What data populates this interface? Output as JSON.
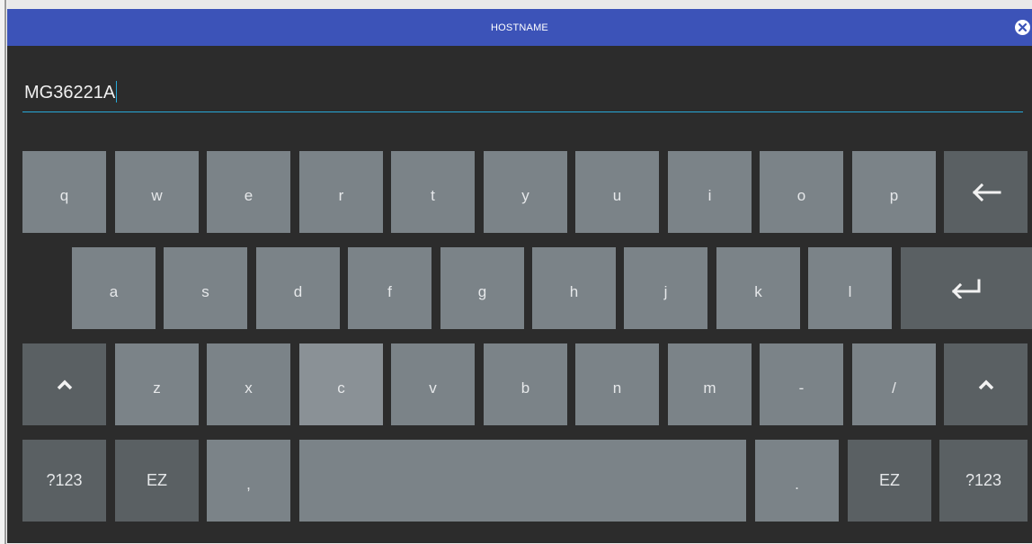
{
  "dialog": {
    "title": "HOSTNAME",
    "close_icon": "close-icon"
  },
  "input": {
    "value": "MG36221A"
  },
  "keyboard": {
    "row1": [
      "q",
      "w",
      "e",
      "r",
      "t",
      "y",
      "u",
      "i",
      "o",
      "p"
    ],
    "row2": [
      "a",
      "s",
      "d",
      "f",
      "g",
      "h",
      "j",
      "k",
      "l"
    ],
    "row3": [
      "z",
      "x",
      "c",
      "v",
      "b",
      "n",
      "m",
      "-",
      "/"
    ],
    "row4": {
      "left_symbols": "?123",
      "left_ez": "EZ",
      "comma": ",",
      "period": ".",
      "right_ez": "EZ",
      "right_symbols": "?123"
    },
    "icons": {
      "backspace": "backspace-icon",
      "enter": "enter-icon",
      "shift_left": "shift-icon",
      "shift_right": "shift-icon"
    },
    "highlighted_key": "c"
  },
  "colors": {
    "title_bar": "#3c53b8",
    "background": "#2c2c2c",
    "key": "#7b8388",
    "key_special": "#5a6063",
    "input_underline": "#27a8d8"
  }
}
